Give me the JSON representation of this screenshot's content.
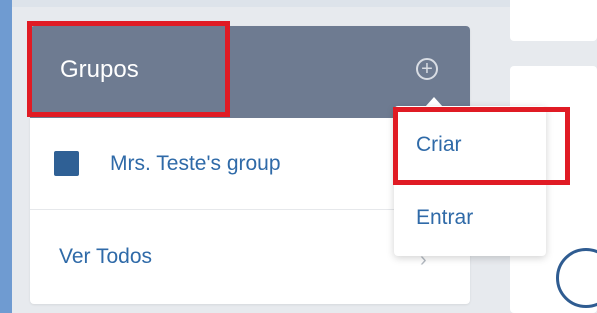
{
  "groups_panel": {
    "title": "Grupos",
    "add_icon": "plus-circle-icon",
    "group": {
      "name": "Mrs. Teste's group",
      "color": "#2f6095"
    },
    "view_all_label": "Ver Todos",
    "view_all_icon": "chevron-right-icon"
  },
  "dropdown": {
    "items": [
      {
        "label": "Criar"
      },
      {
        "label": "Entrar"
      }
    ]
  },
  "colors": {
    "header_bg": "#6e7b91",
    "link": "#2f6aa8",
    "highlight": "#e01b24"
  }
}
